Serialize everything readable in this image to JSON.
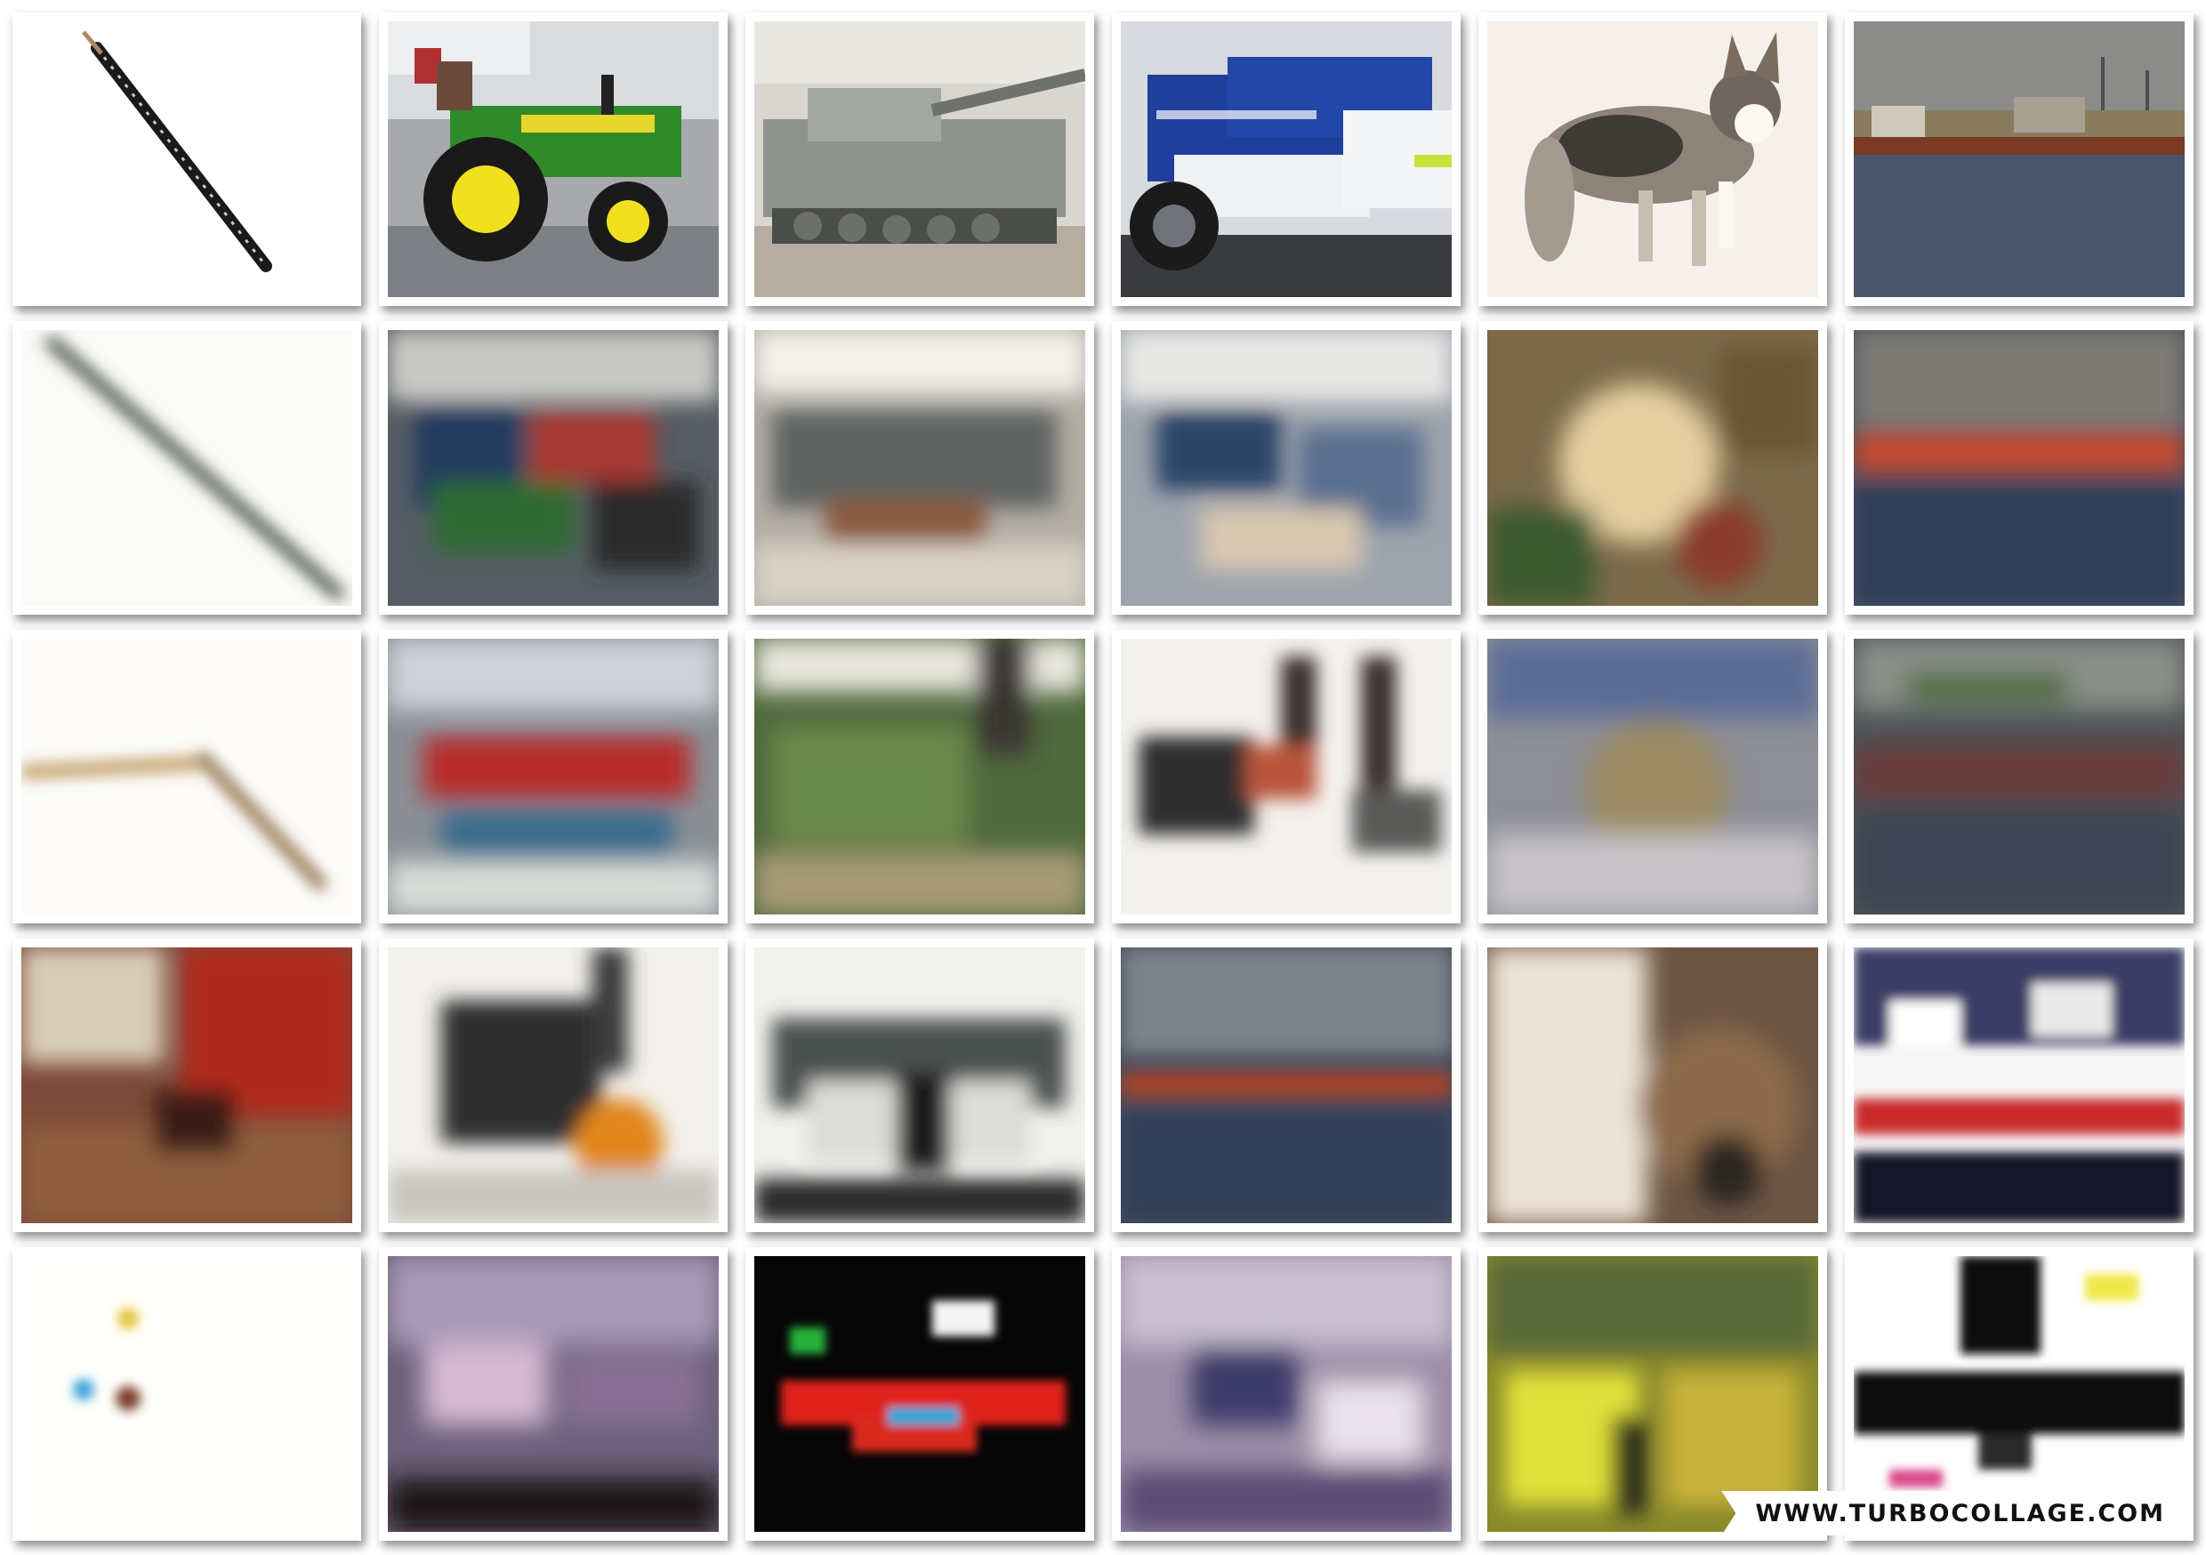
{
  "watermark": {
    "text": "WWW.TURBOCOLLAGE.COM"
  },
  "rows": [
    {
      "row": "original",
      "tiles": [
        {
          "subject": "oboe",
          "bg": "#ffffff"
        },
        {
          "subject": "tractor",
          "bg": "#9aa0a4"
        },
        {
          "subject": "tank",
          "bg": "#cfcac2"
        },
        {
          "subject": "police-motorcycle",
          "bg": "#e8eaee"
        },
        {
          "subject": "corgi-dog",
          "bg": "#f5f1ea"
        },
        {
          "subject": "harbor-ship",
          "bg": "#6b7079"
        }
      ]
    },
    {
      "row": "reconstruction-1"
    },
    {
      "row": "reconstruction-2"
    },
    {
      "row": "reconstruction-3"
    },
    {
      "row": "reconstruction-4"
    }
  ]
}
